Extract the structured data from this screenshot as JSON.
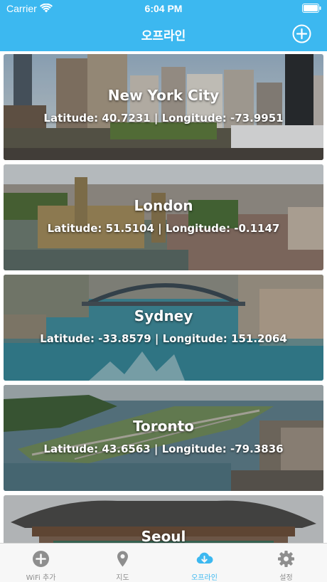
{
  "status_bar": {
    "carrier": "Carrier",
    "time": "6:04 PM",
    "icons": [
      "wifi-icon",
      "battery-icon"
    ]
  },
  "nav": {
    "title": "오프라인",
    "add_icon": "plus-circle-icon"
  },
  "cities": [
    {
      "name": "New York City",
      "coords": "Latitude: 40.7231 | Longitude: -73.9951"
    },
    {
      "name": "London",
      "coords": "Latitude: 51.5104 | Longitude: -0.1147"
    },
    {
      "name": "Sydney",
      "coords": "Latitude: -33.8579 | Longitude: 151.2064"
    },
    {
      "name": "Toronto",
      "coords": "Latitude: 43.6563 | Longitude: -79.3836"
    },
    {
      "name": "Seoul",
      "coords": ""
    }
  ],
  "tabs": [
    {
      "label": "WiFi 추가",
      "icon": "plus-circle-icon"
    },
    {
      "label": "지도",
      "icon": "map-pin-icon"
    },
    {
      "label": "오프라인",
      "icon": "cloud-download-icon"
    },
    {
      "label": "설정",
      "icon": "gear-icon"
    }
  ],
  "colors": {
    "accent": "#3cb8f0",
    "tab_inactive": "#8e8e8e",
    "tabbar_bg": "#f7f7f7"
  }
}
